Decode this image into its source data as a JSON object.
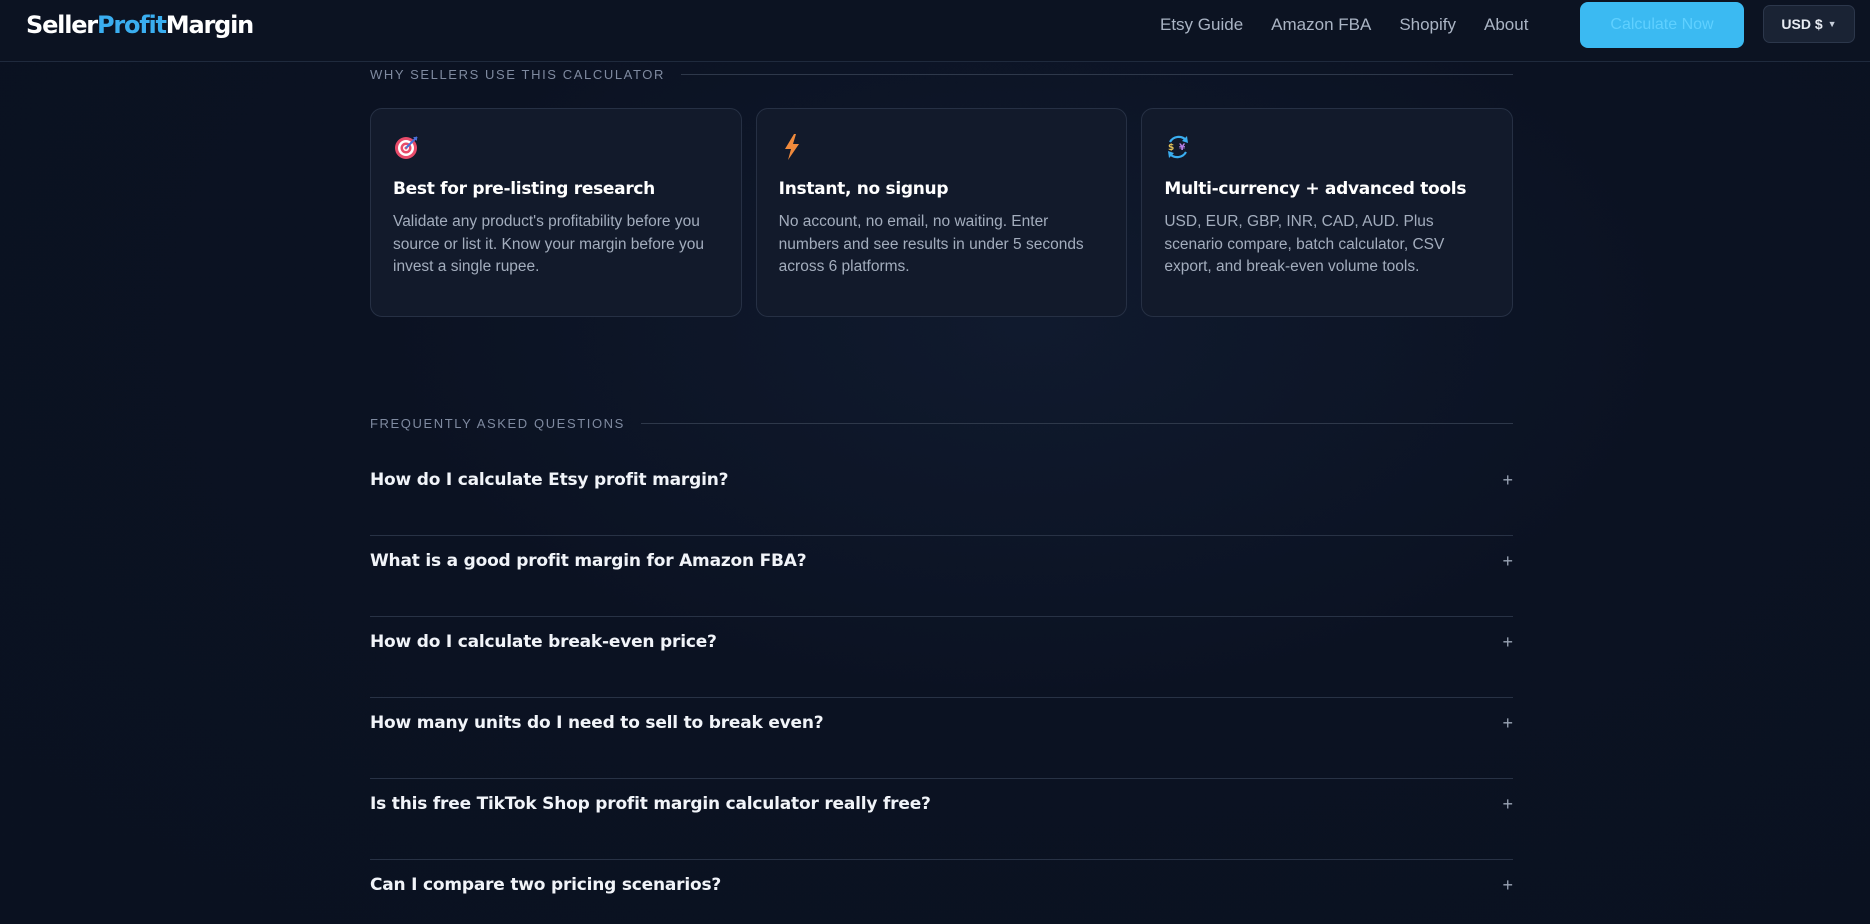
{
  "header": {
    "logo_part1": "Seller",
    "logo_part2": "Profit",
    "logo_part3": "Margin",
    "nav": [
      "Etsy Guide",
      "Amazon FBA",
      "Shopify",
      "About"
    ],
    "cta_label": "Calculate Now",
    "currency_label": "USD $",
    "cta_color": "#3bbaf2"
  },
  "why": {
    "label": "WHY SELLERS USE THIS CALCULATOR",
    "cards": [
      {
        "icon": "target-icon",
        "title": "Best for pre-listing research",
        "desc": "Validate any product's profitability before you source or list it. Know your margin before you invest a single rupee."
      },
      {
        "icon": "lightning-icon",
        "title": "Instant, no signup",
        "desc": "No account, no email, no waiting. Enter numbers and see results in under 5 seconds across 6 platforms."
      },
      {
        "icon": "currency-exchange-icon",
        "title": "Multi-currency + advanced tools",
        "desc": "USD, EUR, GBP, INR, CAD, AUD. Plus scenario compare, batch calculator, CSV export, and break-even volume tools."
      }
    ]
  },
  "faq": {
    "label": "FREQUENTLY ASKED QUESTIONS",
    "items": [
      "How do I calculate Etsy profit margin?",
      "What is a good profit margin for Amazon FBA?",
      "How do I calculate break-even price?",
      "How many units do I need to sell to break even?",
      "Is this free TikTok Shop profit margin calculator really free?",
      "Can I compare two pricing scenarios?"
    ],
    "expand_symbol": "+"
  }
}
